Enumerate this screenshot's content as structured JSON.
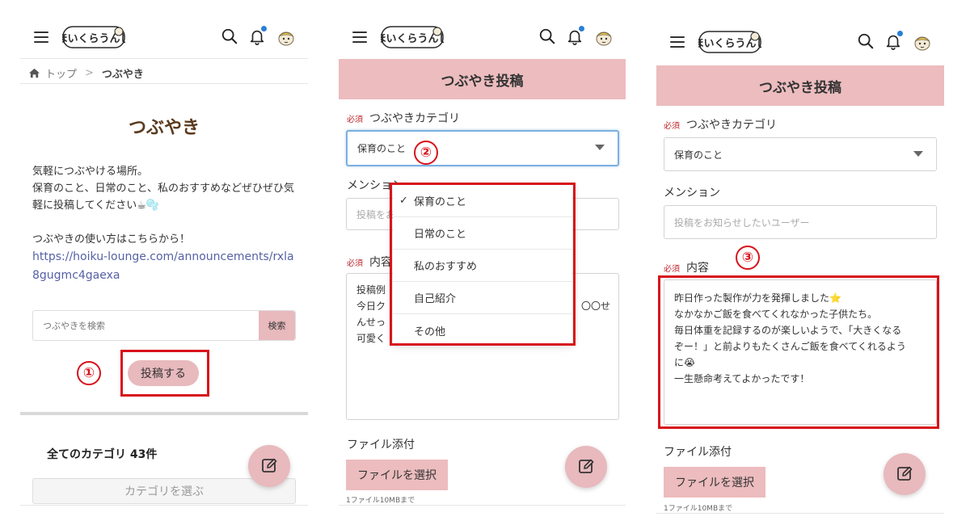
{
  "header": {
    "logo_text": "ほいくらうんじ"
  },
  "screen1": {
    "breadcrumb": {
      "home": "トップ",
      "separator": ">",
      "current": "つぶやき"
    },
    "title": "つぶやき",
    "description_line1": "気軽につぶやける場所。",
    "description_line2": "保育のこと、日常のこと、私のおすすめなどぜひぜひ気軽に投稿してください☕🫧",
    "howto": "つぶやきの使い方はこちらから！",
    "howto_link": "https://hoiku-lounge.com/announcements/rxla8gugmc4gaexa",
    "search_placeholder": "つぶやきを検索",
    "search_button": "検索",
    "post_button": "投稿する",
    "category_count": "全てのカテゴリ 43件",
    "category_select": "カテゴリを選ぶ",
    "step_marker": "①"
  },
  "screen2": {
    "heading": "つぶやき投稿",
    "required": "必須",
    "category_label": "つぶやきカテゴリ",
    "category_value": "保育のこと",
    "mention_label": "メンション",
    "mention_placeholder": "投稿をお",
    "content_label": "内容",
    "content_lines": [
      "投稿例",
      "今日ク",
      "んせっ",
      "可愛く"
    ],
    "content_right": "〇〇せ",
    "options": [
      {
        "label": "保育のこと",
        "checked": true
      },
      {
        "label": "日常のこと",
        "checked": false
      },
      {
        "label": "私のおすすめ",
        "checked": false
      },
      {
        "label": "自己紹介",
        "checked": false
      },
      {
        "label": "その他",
        "checked": false
      }
    ],
    "check_mark": "✓",
    "file_label": "ファイル添付",
    "file_button": "ファイルを選択",
    "file_note": "1ファイル10MBまで",
    "step_marker": "②"
  },
  "screen3": {
    "heading": "つぶやき投稿",
    "required": "必須",
    "category_label": "つぶやきカテゴリ",
    "category_value": "保育のこと",
    "mention_label": "メンション",
    "mention_placeholder": "投稿をお知らせしたいユーザー",
    "content_label": "内容",
    "content_lines": [
      "昨日作った製作が力を発揮しました⭐",
      "なかなかご飯を食べてくれなかった子供たち。",
      "毎日体重を記録するのが楽しいようで、「大きくなる",
      "ぞー！」と前よりもたくさんご飯を食べてくれるよう",
      "に😭",
      "一生懸命考えてよかったです！"
    ],
    "file_label": "ファイル添付",
    "file_button": "ファイルを選択",
    "file_note": "1ファイル10MBまで",
    "step_marker": "③"
  },
  "colors": {
    "accent_pink": "#ecbcbe",
    "highlight_red": "#d8121a",
    "title_brown": "#5a3a1e",
    "link_blue": "#5561a6"
  },
  "icons": [
    "menu-icon",
    "search-icon",
    "bell-icon",
    "avatar-icon",
    "home-icon",
    "edit-icon"
  ]
}
